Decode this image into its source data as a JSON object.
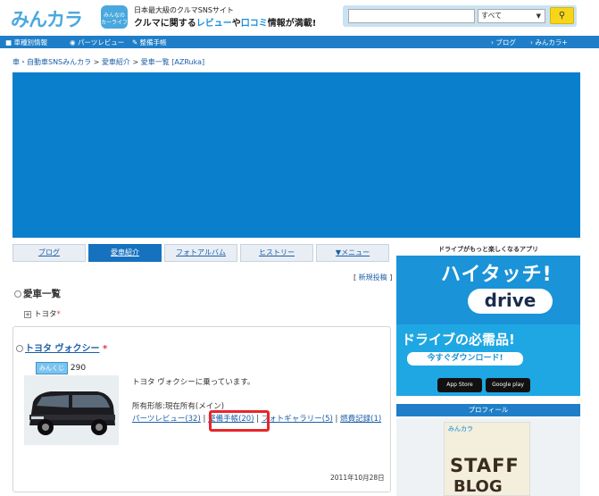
{
  "header": {
    "logo": "みんカラ",
    "logo_badge": "みんなの\nカーライフ",
    "tagline_small": "日本最大級のクルマSNSサイト",
    "tagline_pre": "クルマに関する",
    "tagline_review": "レビュー",
    "tagline_mid": "や",
    "tagline_kuchikomi": "口コミ",
    "tagline_post": "情報が満載!",
    "search_placeholder": "",
    "search_select": "すべて",
    "search_button_icon": "search-icon"
  },
  "navbar": {
    "items": [
      "車種別情報",
      "パーツレビュー",
      "整備手帳"
    ],
    "right": [
      "ブログ",
      "みんカラ+"
    ]
  },
  "breadcrumb": [
    "車・自動車SNSみんカラ",
    "愛車紹介",
    "愛車一覧 [AZRuka]"
  ],
  "tabs": [
    "ブログ",
    "愛車紹介",
    "フォトアルバム",
    "ヒストリー",
    "▼メニュー"
  ],
  "new_post": "新規投稿",
  "section_title": "愛車一覧",
  "tree_item": "トヨタ",
  "car": {
    "title": "トヨタ ヴォクシー",
    "mikuji_label": "みんくじ",
    "mikuji_count": "290",
    "description": "トヨタ ヴォクシーに乗っています。",
    "ownership_label": "所有形態:",
    "ownership_value": "現在所有(メイン)",
    "link_parts": "パーツレビュー(32)",
    "link_maintenance": "整備手帳(20)",
    "link_photo": "フォトギャラリー(5)",
    "link_fuel": "燃費記録(1)",
    "date": "2011年10月28日"
  },
  "sidebar": {
    "ad_top": "ドライブがもっと楽しくなるアプリ",
    "ad_title": "ハイタッチ!",
    "ad_drive": "drive",
    "ad_must": "ドライブの必需品!",
    "ad_download": "今すぐダウンロード!",
    "store_apple": "App Store",
    "store_google": "Google play",
    "profile_head": "プロフィール",
    "staff_logo": "みんカラ",
    "staff_text": "STAFF",
    "staff_blog": "BLOG"
  },
  "colors": {
    "brand_blue": "#1f7ec7",
    "ad_blue": "#0a7fcc",
    "highlight_red": "#e8252a",
    "search_yellow": "#f7d51a"
  }
}
